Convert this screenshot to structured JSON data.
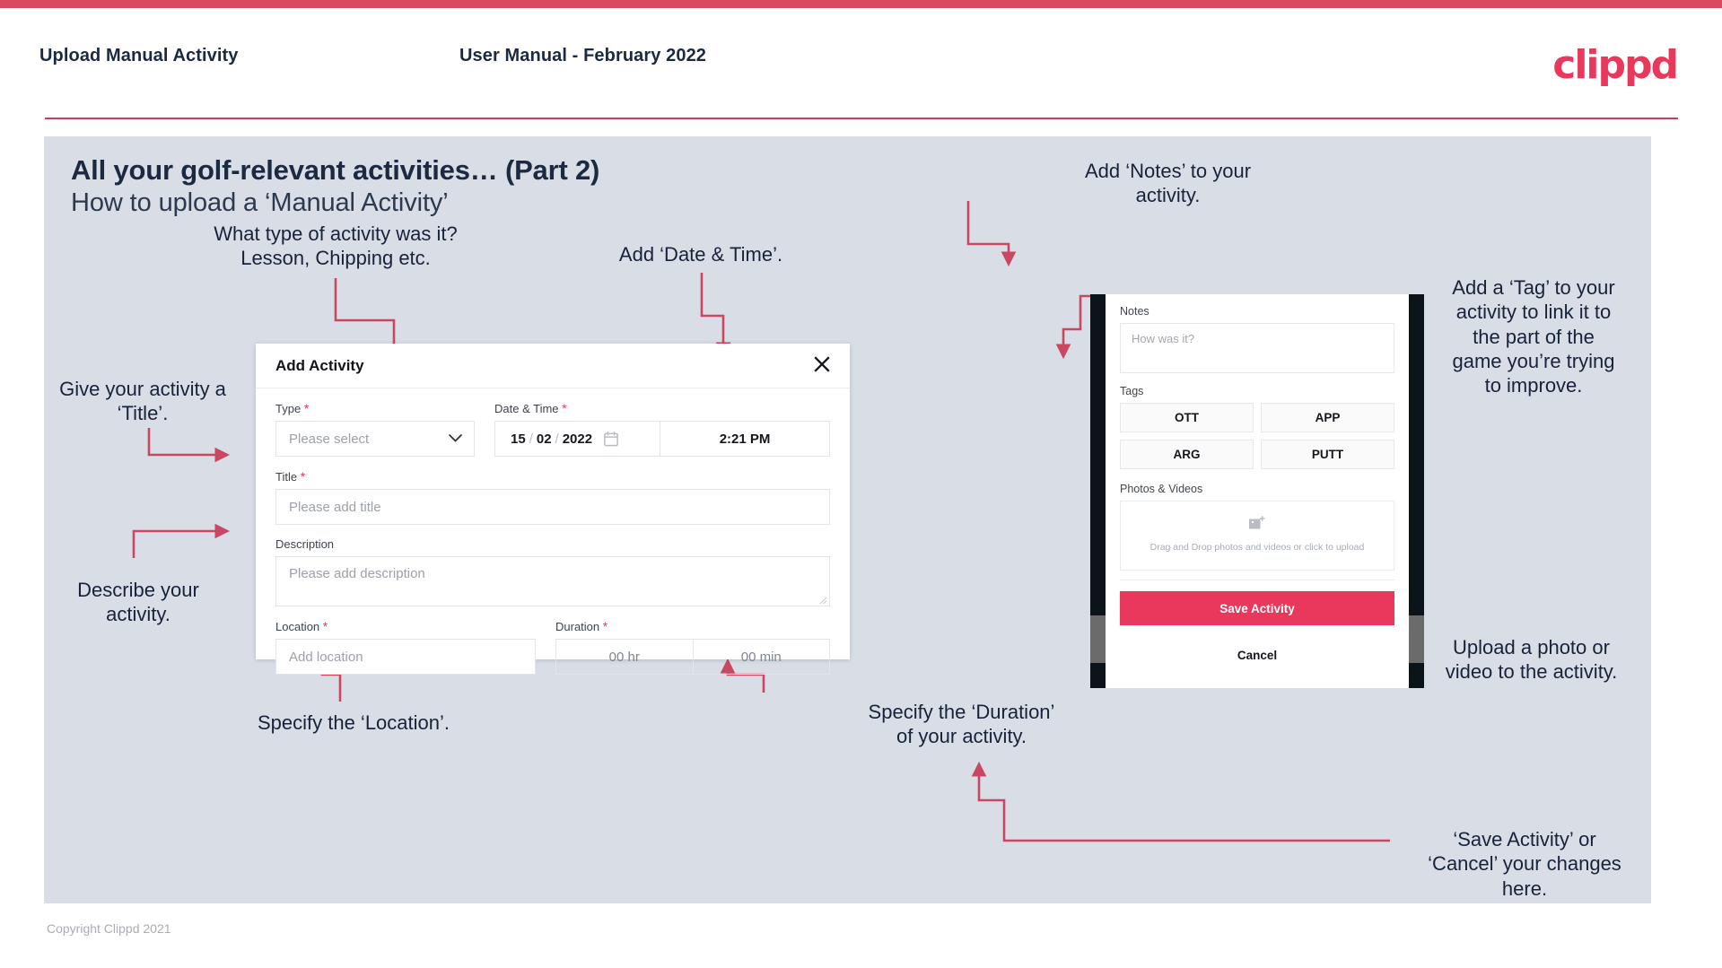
{
  "header": {
    "left_title": "Upload Manual Activity",
    "center_title": "User Manual - February 2022",
    "logo": "clippd"
  },
  "slide": {
    "title_main": "All your golf-relevant activities… (Part 2)",
    "title_sub": "How to upload a ‘Manual Activity’"
  },
  "annotations": {
    "type": "What type of activity was it?\nLesson, Chipping etc.",
    "datetime": "Add ‘Date & Time’.",
    "title": "Give your activity a\n‘Title’.",
    "description": "Describe your\nactivity.",
    "location": "Specify the ‘Location’.",
    "duration": "Specify the ‘Duration’\nof your activity.",
    "notes": "Add ‘Notes’ to your\nactivity.",
    "tags": "Add a ‘Tag’ to your\nactivity to link it to\nthe part of the\ngame you’re trying\nto improve.",
    "photos": "Upload a photo or\nvideo to the activity.",
    "save_cancel": "‘Save Activity’ or\n‘Cancel’ your changes\nhere."
  },
  "dialog": {
    "title": "Add Activity",
    "close_icon": "close-icon",
    "fields": {
      "type_label": "Type",
      "type_placeholder": "Please select",
      "datetime_label": "Date & Time",
      "date_day": "15",
      "date_month": "02",
      "date_year": "2022",
      "date_sep": "/",
      "time_value": "2:21 PM",
      "calendar_icon": "calendar-icon",
      "chevron_icon": "chevron-down-icon",
      "title_label": "Title",
      "title_placeholder": "Please add title",
      "description_label": "Description",
      "description_placeholder": "Please add description",
      "location_label": "Location",
      "location_placeholder": "Add location",
      "duration_label": "Duration",
      "duration_hr": "00 hr",
      "duration_min": "00 min",
      "required_marker": "*"
    }
  },
  "phone": {
    "notes_label": "Notes",
    "notes_placeholder": "How was it?",
    "tags_label": "Tags",
    "tags": [
      "OTT",
      "APP",
      "ARG",
      "PUTT"
    ],
    "photos_label": "Photos & Videos",
    "upload_icon": "add-image-icon",
    "upload_text": "Drag and Drop photos and videos or click to upload",
    "save_label": "Save Activity",
    "cancel_label": "Cancel"
  },
  "footer": {
    "copyright": "Copyright Clippd 2021"
  },
  "colors": {
    "accent": "#e8385c",
    "top_bar": "#d94a5f",
    "arrow": "#c94760",
    "slide_bg": "#d9dee6",
    "text_dark": "#1b2a41"
  }
}
